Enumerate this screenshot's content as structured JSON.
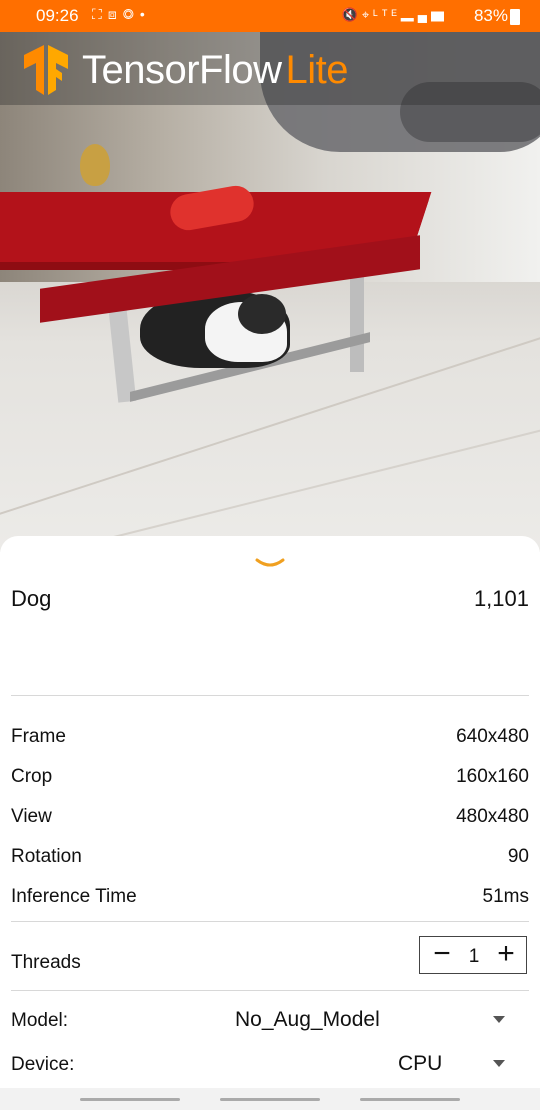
{
  "status_bar": {
    "time": "09:26",
    "battery": "83%",
    "left_icons": [
      "screenshot-icon",
      "screen-record-icon",
      "nfc-icon",
      "dot-icon"
    ],
    "right_icons": [
      "mute-icon",
      "location-icon",
      "volte-icon",
      "signal-icon",
      "battery-icon"
    ]
  },
  "app_bar": {
    "brand_main": "TensorFlow",
    "brand_accent": "Lite",
    "accent_color": "#ff8a00",
    "status_color": "#ff6f00"
  },
  "result": {
    "label": "Dog",
    "score": "1,101"
  },
  "info": [
    {
      "label": "Frame",
      "value": "640x480"
    },
    {
      "label": "Crop",
      "value": "160x160"
    },
    {
      "label": "View",
      "value": "480x480"
    },
    {
      "label": "Rotation",
      "value": "90"
    },
    {
      "label": "Inference Time",
      "value": "51ms"
    }
  ],
  "threads": {
    "label": "Threads",
    "value": "1",
    "minus": "−",
    "plus": "+"
  },
  "model": {
    "label": "Model:",
    "selected": "No_Aug_Model"
  },
  "device": {
    "label": "Device:",
    "selected": "CPU"
  }
}
